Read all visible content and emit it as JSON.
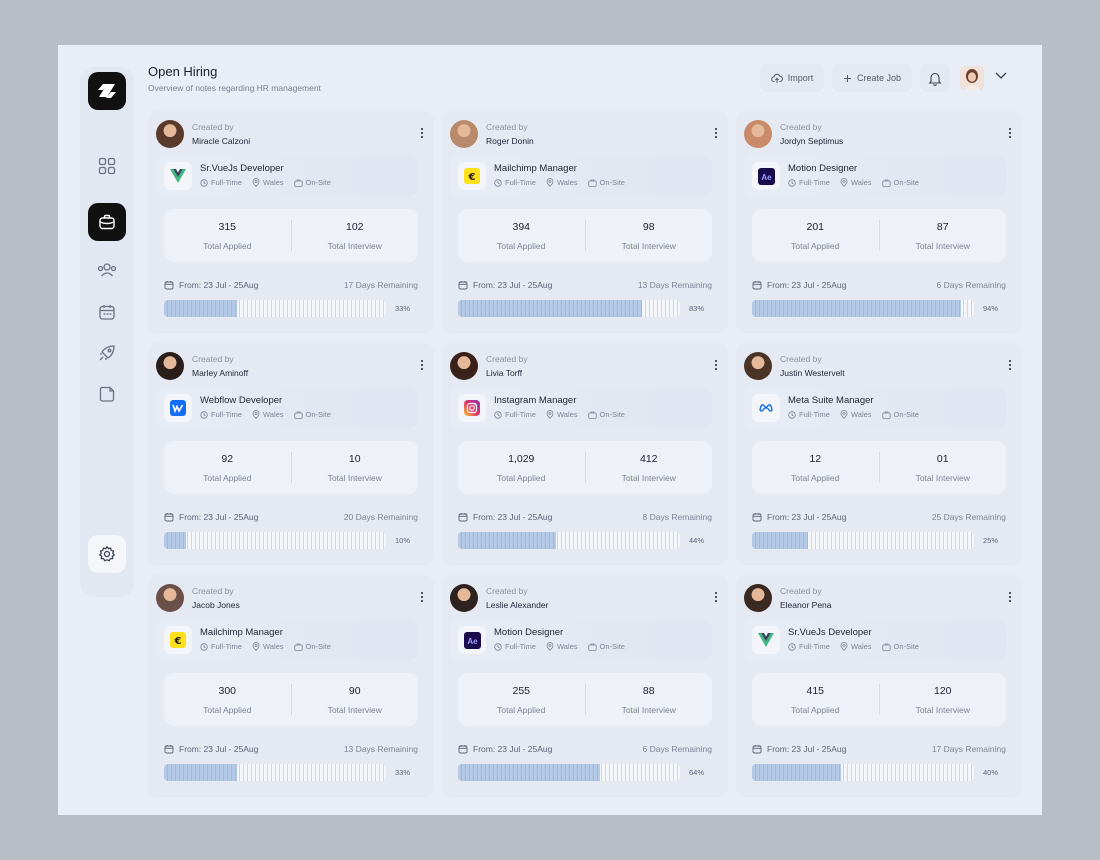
{
  "header": {
    "title": "Open Hiring",
    "subtitle": "Overview of notes regarding HR management",
    "import_label": "Import",
    "create_label": "Create Job"
  },
  "sidebar": {
    "items": [
      {
        "name": "grid-icon"
      },
      {
        "name": "briefcase-icon",
        "active": true
      },
      {
        "name": "users-icon"
      },
      {
        "name": "calendar-icon"
      },
      {
        "name": "rocket-icon"
      },
      {
        "name": "folder-icon"
      }
    ],
    "settings": "gear-icon"
  },
  "labels": {
    "created_by": "Created by",
    "total_applied": "Total Applied",
    "total_interview": "Total Interview"
  },
  "cards": [
    {
      "creator": "Miracle Calzoni",
      "avatar_color": "#5a3a2a",
      "job": "Sr.VueJs Developer",
      "logo": "vue",
      "type": "Full-Time",
      "location": "Wales",
      "mode": "On-Site",
      "applied": "315",
      "interview": "102",
      "dates": "From: 23 Jul - 25Aug",
      "remaining": "17 Days Remaining",
      "progress": 0.33,
      "pct": "33%"
    },
    {
      "creator": "Roger Donin",
      "avatar_color": "#b98a6a",
      "job": "Mailchimp Manager",
      "logo": "mailchimp",
      "type": "Full-Time",
      "location": "Wales",
      "mode": "On-Site",
      "applied": "394",
      "interview": "98",
      "dates": "From: 23 Jul - 25Aug",
      "remaining": "13 Days Remaining",
      "progress": 0.83,
      "pct": "83%"
    },
    {
      "creator": "Jordyn Septimus",
      "avatar_color": "#c98a6a",
      "job": "Motion Designer",
      "logo": "ae",
      "type": "Full-Time",
      "location": "Wales",
      "mode": "On-Site",
      "applied": "201",
      "interview": "87",
      "dates": "From: 23 Jul - 25Aug",
      "remaining": "6 Days Remaining",
      "progress": 0.94,
      "pct": "94%"
    },
    {
      "creator": "Marley Aminoff",
      "avatar_color": "#2a1e1a",
      "job": "Webflow Developer",
      "logo": "webflow",
      "type": "Full-Time",
      "location": "Wales",
      "mode": "On-Site",
      "applied": "92",
      "interview": "10",
      "dates": "From: 23 Jul - 25Aug",
      "remaining": "20 Days Remaining",
      "progress": 0.1,
      "pct": "10%"
    },
    {
      "creator": "Livia Torff",
      "avatar_color": "#3a221a",
      "job": "Instagram Manager",
      "logo": "instagram",
      "type": "Full-Time",
      "location": "Wales",
      "mode": "On-Site",
      "applied": "1,029",
      "interview": "412",
      "dates": "From: 23 Jul - 25Aug",
      "remaining": "8 Days Remaining",
      "progress": 0.44,
      "pct": "44%"
    },
    {
      "creator": "Justin Westervelt",
      "avatar_color": "#4a3428",
      "job": "Meta Suite Manager",
      "logo": "meta",
      "type": "Full-Time",
      "location": "Wales",
      "mode": "On-Site",
      "applied": "12",
      "interview": "01",
      "dates": "From: 23 Jul - 25Aug",
      "remaining": "25 Days Remaining",
      "progress": 0.25,
      "pct": "25%"
    },
    {
      "creator": "Jacob Jones",
      "avatar_color": "#6a5048",
      "job": "Mailchimp Manager",
      "logo": "mailchimp",
      "type": "Full-Time",
      "location": "Wales",
      "mode": "On-Site",
      "applied": "300",
      "interview": "90",
      "dates": "From: 23 Jul - 25Aug",
      "remaining": "13 Days Remaining",
      "progress": 0.33,
      "pct": "33%"
    },
    {
      "creator": "Leslie Alexander",
      "avatar_color": "#2e2220",
      "job": "Motion Designer",
      "logo": "ae",
      "type": "Full-Time",
      "location": "Wales",
      "mode": "On-Site",
      "applied": "255",
      "interview": "88",
      "dates": "From: 23 Jul - 25Aug",
      "remaining": "6 Days Remaining",
      "progress": 0.64,
      "pct": "64%"
    },
    {
      "creator": "Eleanor Pena",
      "avatar_color": "#3a2a22",
      "job": "Sr.VueJs Developer",
      "logo": "vue",
      "type": "Full-Time",
      "location": "Wales",
      "mode": "On-Site",
      "applied": "415",
      "interview": "120",
      "dates": "From: 23 Jul - 25Aug",
      "remaining": "17 Days Remaining",
      "progress": 0.4,
      "pct": "40%"
    }
  ]
}
